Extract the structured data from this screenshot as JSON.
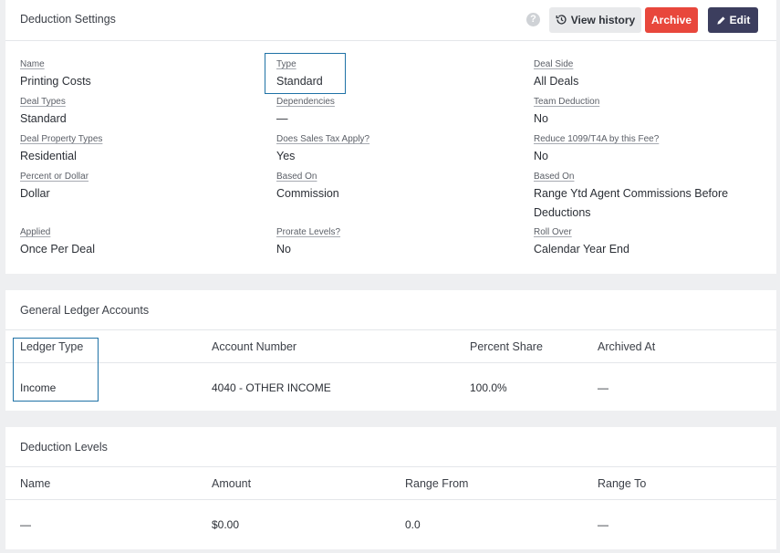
{
  "settings": {
    "title": "Deduction Settings",
    "help_symbol": "?",
    "buttons": {
      "view_history": "View history",
      "archive": "Archive",
      "edit": "Edit"
    },
    "fields": {
      "name": {
        "label": "Name",
        "value": "Printing Costs"
      },
      "type": {
        "label": "Type",
        "value": "Standard"
      },
      "deal_side": {
        "label": "Deal Side",
        "value": "All Deals"
      },
      "deal_types": {
        "label": "Deal Types",
        "value": "Standard"
      },
      "dependencies": {
        "label": "Dependencies",
        "value": "—"
      },
      "team_deduction": {
        "label": "Team Deduction",
        "value": "No"
      },
      "deal_property_types": {
        "label": "Deal Property Types",
        "value": "Residential"
      },
      "sales_tax": {
        "label": "Does Sales Tax Apply?",
        "value": "Yes"
      },
      "reduce_1099": {
        "label": "Reduce 1099/T4A by this Fee?",
        "value": "No"
      },
      "percent_or_dollar": {
        "label": "Percent or Dollar",
        "value": "Dollar"
      },
      "based_on_1": {
        "label": "Based On",
        "value": "Commission"
      },
      "based_on_2": {
        "label": "Based On",
        "value_line1": "Range Ytd Agent Commissions Before",
        "value_line2": "Deductions"
      },
      "applied": {
        "label": "Applied",
        "value": "Once Per Deal"
      },
      "prorate_levels": {
        "label": "Prorate Levels?",
        "value": "No"
      },
      "roll_over": {
        "label": "Roll Over",
        "value": "Calendar Year End"
      }
    }
  },
  "ledger": {
    "title": "General Ledger Accounts",
    "headers": [
      "Ledger Type",
      "Account Number",
      "Percent Share",
      "Archived At"
    ],
    "rows": [
      [
        "Income",
        "4040 - OTHER INCOME",
        "100.0%",
        "—"
      ]
    ]
  },
  "levels": {
    "title": "Deduction Levels",
    "headers": [
      "Name",
      "Amount",
      "Range From",
      "Range To"
    ],
    "rows": [
      [
        "—",
        "$0.00",
        "0.0",
        "—"
      ]
    ]
  },
  "colors": {
    "archive": "#e8473c",
    "edit": "#3c3e5e",
    "highlight": "#1f72a6"
  },
  "icons": {
    "help": "question-circle-icon",
    "history": "history-clock-icon",
    "edit": "pencil-icon"
  }
}
